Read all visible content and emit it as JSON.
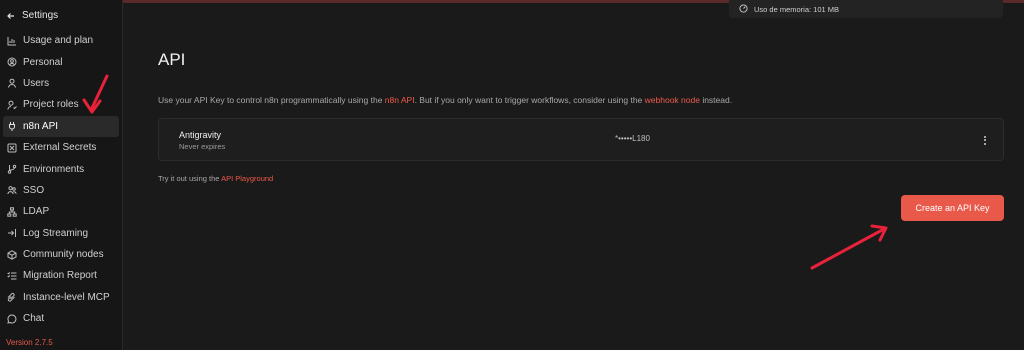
{
  "sidebar": {
    "back_label": "Settings",
    "items": [
      {
        "label": "Usage and plan",
        "icon": "chart-icon"
      },
      {
        "label": "Personal",
        "icon": "user-circle-icon"
      },
      {
        "label": "Users",
        "icon": "user-icon"
      },
      {
        "label": "Project roles",
        "icon": "user-check-icon"
      },
      {
        "label": "n8n API",
        "icon": "plug-icon",
        "active": true
      },
      {
        "label": "External Secrets",
        "icon": "box-x-icon"
      },
      {
        "label": "Environments",
        "icon": "git-branch-icon"
      },
      {
        "label": "SSO",
        "icon": "users-icon"
      },
      {
        "label": "LDAP",
        "icon": "network-icon"
      },
      {
        "label": "Log Streaming",
        "icon": "log-in-icon"
      },
      {
        "label": "Community nodes",
        "icon": "cube-icon"
      },
      {
        "label": "Migration Report",
        "icon": "list-check-icon"
      },
      {
        "label": "Instance-level MCP",
        "icon": "mcp-icon"
      },
      {
        "label": "Chat",
        "icon": "chat-icon"
      }
    ],
    "version": "Version 2.7.5"
  },
  "memory": {
    "label": "Uso de memoria: 101 MB",
    "icon": "gauge-icon"
  },
  "main": {
    "title": "API",
    "description": {
      "part1": "Use your API Key to control n8n programmatically using the ",
      "link1": "n8n API",
      "part2": ". But if you only want to trigger workflows, consider using the ",
      "link2": "webhook node",
      "part3": " instead."
    },
    "api_key": {
      "name": "Antigravity",
      "expiry": "Never expires",
      "masked_key": "*•••••L180"
    },
    "tryout": {
      "prefix": "Try it out using the ",
      "link": "API Playground"
    },
    "create_button": "Create an API Key"
  },
  "colors": {
    "accent": "#e8594a",
    "annotation_arrow": "#e8223a",
    "background": "#1a1a1a"
  }
}
